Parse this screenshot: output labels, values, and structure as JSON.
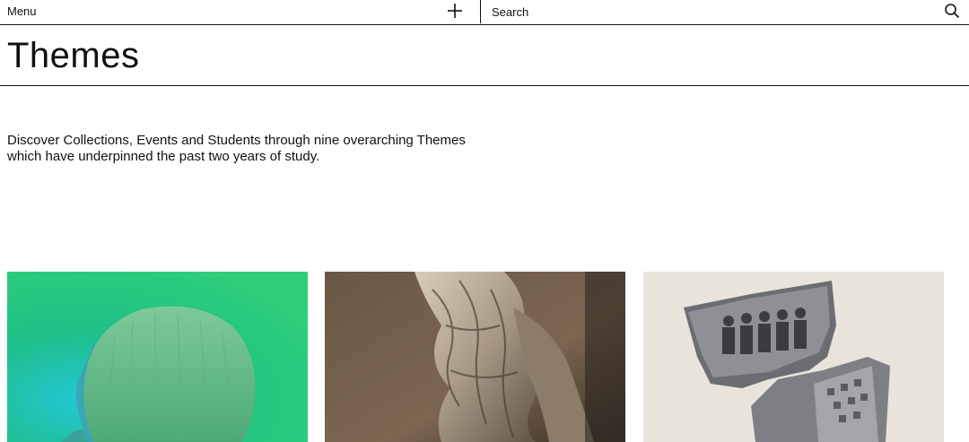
{
  "nav": {
    "menu_label": "Menu",
    "add_icon": "plus-icon",
    "search_placeholder": "Search",
    "search_icon": "magnifier-icon"
  },
  "page": {
    "title": "Themes",
    "intro": "Discover Collections, Events and Students through nine overarching Themes which have underpinned the past two years of study."
  },
  "theme_cards": [
    {
      "image": "green-lit-portrait-profile"
    },
    {
      "image": "draped-marble-sculpture"
    },
    {
      "image": "torn-group-photograph-collage"
    }
  ],
  "colors": {
    "text": "#111111",
    "background": "#ffffff",
    "rule": "#111111"
  }
}
